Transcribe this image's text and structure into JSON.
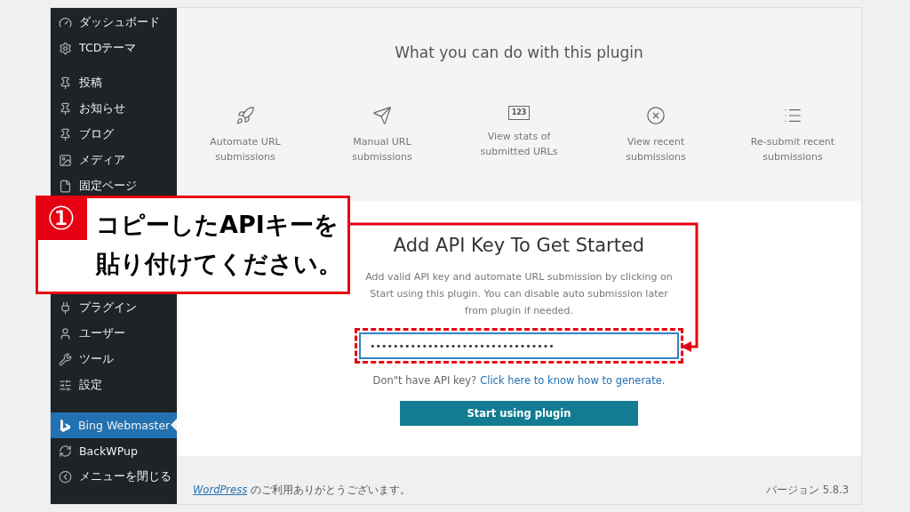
{
  "sidebar": {
    "groups": [
      {
        "items": [
          {
            "label": "ダッシュボード",
            "selected": false
          },
          {
            "label": "TCDテーマ",
            "selected": false
          }
        ]
      },
      {
        "items": [
          {
            "label": "投稿",
            "selected": false
          },
          {
            "label": "お知らせ",
            "selected": false
          },
          {
            "label": "ブログ",
            "selected": false
          },
          {
            "label": "メディア",
            "selected": false
          },
          {
            "label": "固定ページ",
            "selected": false
          }
        ]
      },
      {
        "items": [
          {
            "label": "プラグイン",
            "selected": false
          },
          {
            "label": "ユーザー",
            "selected": false
          },
          {
            "label": "ツール",
            "selected": false
          },
          {
            "label": "設定",
            "selected": false
          }
        ]
      },
      {
        "items": [
          {
            "label": "Bing Webmaster",
            "selected": true
          },
          {
            "label": "BackWPup",
            "selected": false
          },
          {
            "label": "メニューを閉じる",
            "selected": false
          }
        ]
      }
    ]
  },
  "features": {
    "title": "What you can do with this plugin",
    "items": [
      {
        "label": "Automate URL submissions"
      },
      {
        "label": "Manual URL submissions"
      },
      {
        "icon_text": "123",
        "label": "View stats of submitted URLs"
      },
      {
        "label": "View recent submissions"
      },
      {
        "label": "Re-submit recent submissions"
      }
    ]
  },
  "setup": {
    "heading": "Add API Key To Get Started",
    "description": "Add valid API key and automate URL submission by clicking on Start using this plugin. You can disable auto submission later from plugin if needed.",
    "api_key_value": "••••••••••••••••••••••••••••••••",
    "help_text": "Don\"t have API key?",
    "help_link": "Click here to know how to generate.",
    "button": "Start using plugin"
  },
  "footer": {
    "link": "WordPress",
    "thanks": "のご利用ありがとうございます。",
    "version": "バージョン 5.8.3"
  },
  "callout": {
    "number": "①",
    "lines": [
      "コピーしたAPIキーを",
      "貼り付けてください。"
    ]
  }
}
